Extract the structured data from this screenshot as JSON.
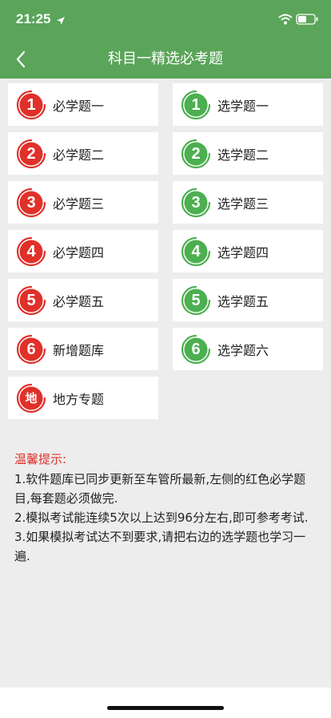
{
  "status_bar": {
    "time": "21:25"
  },
  "header": {
    "title": "科目一精选必考题"
  },
  "colors": {
    "header": "#5aa55a",
    "red": "#e0302a",
    "green": "#4caf50"
  },
  "left_items": [
    {
      "badge": "1",
      "label": "必学题一"
    },
    {
      "badge": "2",
      "label": "必学题二"
    },
    {
      "badge": "3",
      "label": "必学题三"
    },
    {
      "badge": "4",
      "label": "必学题四"
    },
    {
      "badge": "5",
      "label": "必学题五"
    },
    {
      "badge": "6",
      "label": "新增题库"
    },
    {
      "badge": "地",
      "label": "地方专题"
    }
  ],
  "right_items": [
    {
      "badge": "1",
      "label": "选学题一"
    },
    {
      "badge": "2",
      "label": "选学题二"
    },
    {
      "badge": "3",
      "label": "选学题三"
    },
    {
      "badge": "4",
      "label": "选学题四"
    },
    {
      "badge": "5",
      "label": "选学题五"
    },
    {
      "badge": "6",
      "label": "选学题六"
    }
  ],
  "tips": {
    "title": "温馨提示:",
    "lines": [
      "1.软件题库已同步更新至车管所最新,左侧的红色必学题目,每套题必须做完.",
      "2.模拟考试能连续5次以上达到96分左右,即可参考考试.",
      "3.如果模拟考试达不到要求,请把右边的选学题也学习一遍."
    ]
  }
}
